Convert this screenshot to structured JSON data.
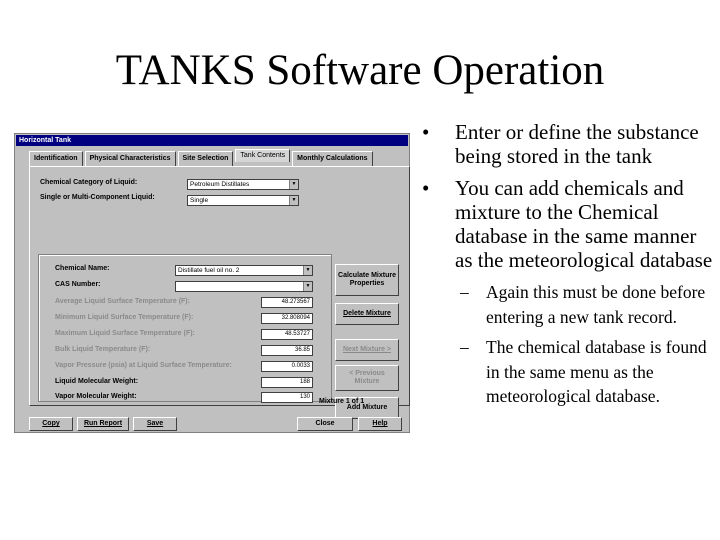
{
  "slide": {
    "title": "TANKS Software Operation",
    "bullets": [
      "Enter or define the substance being stored in the tank",
      "You can add chemicals and mixture to the Chemical database in the same manner as the meteorological database"
    ],
    "sub_bullets": [
      "Again this must be done before entering a new tank record.",
      "The chemical database is found in the same menu as the meteorological database."
    ],
    "bullet_mark": "•",
    "sub_mark": "–"
  },
  "window": {
    "title": "Horizontal Tank",
    "tabs": [
      "Identification",
      "Physical Characteristics",
      "Site Selection",
      "Tank Contents",
      "Monthly Calculations"
    ],
    "active_tab": "Tank Contents",
    "labels": {
      "chem_category": "Chemical Category of Liquid:",
      "single_multi": "Single or Multi-Component Liquid:",
      "chem_name": "Chemical Name:",
      "cas_number": "CAS Number:"
    },
    "values": {
      "chem_category": "Petroleum Distillates",
      "single_multi": "Single",
      "chem_name": "Distillate fuel oil no. 2",
      "cas_number": ""
    },
    "properties": [
      {
        "label": "Average Liquid Surface Temperature (F):",
        "value": "48.273567",
        "dim": true
      },
      {
        "label": "Minimum Liquid Surface Temperature (F):",
        "value": "32.808094",
        "dim": true
      },
      {
        "label": "Maximum Liquid Surface Temperature (F):",
        "value": "48.53727",
        "dim": true
      },
      {
        "label": "Bulk Liquid Temperature (F):",
        "value": "36.85",
        "dim": true
      },
      {
        "label": "Vapor Pressure (psia) at Liquid Surface Temperature:",
        "value": "0.0033",
        "dim": true
      },
      {
        "label": "Liquid Molecular Weight:",
        "value": "188",
        "dim": false
      },
      {
        "label": "Vapor Molecular Weight:",
        "value": "130",
        "dim": false
      }
    ],
    "side_buttons": {
      "calculate": "Calculate Mixture Properties",
      "delete": "Delete Mixture",
      "next": "Next Mixture >",
      "previous": "< Previous Mixture",
      "add": "Add Mixture"
    },
    "mixture_counter": "Mixture 1 of 1",
    "bottom_buttons": {
      "copy": "Copy",
      "run_report": "Run Report",
      "save": "Save",
      "close": "Close",
      "help": "Help"
    },
    "dropdown_glyph": "▼"
  }
}
